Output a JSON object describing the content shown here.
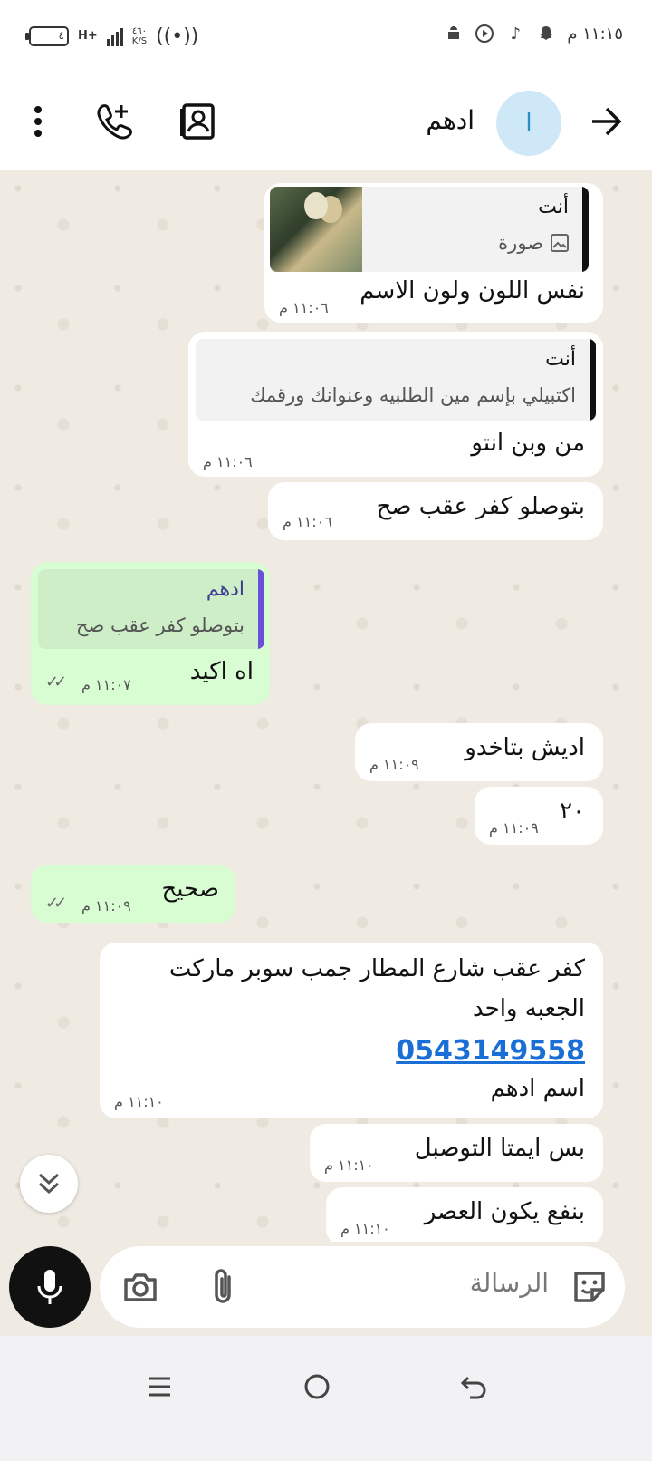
{
  "status_bar": {
    "time": "١١:١٥ م",
    "battery": "٤",
    "network": "H+",
    "speed_value": "٤٦٠",
    "speed_unit": "K/S"
  },
  "header": {
    "contact_name": "ادهم",
    "avatar_letter": "ا"
  },
  "messages": [
    {
      "dir": "in",
      "quote_name": "أنت",
      "quote_text": "صورة",
      "text": "نفس اللون ولون الاسم",
      "time": "١١:٠٦ م"
    },
    {
      "dir": "in",
      "quote_name": "أنت",
      "quote_text": "اكتبيلي بإسم مين الطلبيه وعنوانك ورقمك",
      "text": "من وبن انتو",
      "time": "١١:٠٦ م"
    },
    {
      "dir": "in",
      "text": "بتوصلو كفر عقب صح",
      "time": "١١:٠٦ م"
    },
    {
      "dir": "out",
      "quote_name": "ادهم",
      "quote_text": "بتوصلو كفر عقب صح",
      "text": "اه اكيد",
      "time": "١١:٠٧ م"
    },
    {
      "dir": "in",
      "text": "اديش بتاخدو",
      "time": "١١:٠٩ م"
    },
    {
      "dir": "in",
      "text": "٢٠",
      "time": "١١:٠٩ م"
    },
    {
      "dir": "out",
      "text": "صحيح",
      "time": "١١:٠٩ م"
    },
    {
      "dir": "in",
      "line1": "كفر عقب شارع المطار جمب سوبر ماركت",
      "line2": "الجعبه واحد",
      "phone": "0543149558",
      "line4": "اسم ادهم",
      "time": "١١:١٠ م"
    },
    {
      "dir": "in",
      "text": "بس ايمتا التوصبل",
      "time": "١١:١٠ م"
    },
    {
      "dir": "in",
      "text": "بنفع يكون العصر",
      "time": "١١:١٠ م"
    }
  ],
  "composer": {
    "placeholder": "الرسالة"
  },
  "colors": {
    "incoming": "#ffffff",
    "outgoing": "#d9fdd3",
    "chat_bg": "#efeae2",
    "link": "#1a6fd6",
    "quote_bar_self": "#111111",
    "quote_bar_contact": "#6b4fd8"
  },
  "icons": [
    "back-arrow-icon",
    "add-call-icon",
    "contact-card-icon",
    "more-icon",
    "camera-icon",
    "attach-icon",
    "sticker-icon",
    "mic-icon",
    "scroll-down-icon",
    "menu-icon",
    "home-icon",
    "back-nav-icon"
  ]
}
